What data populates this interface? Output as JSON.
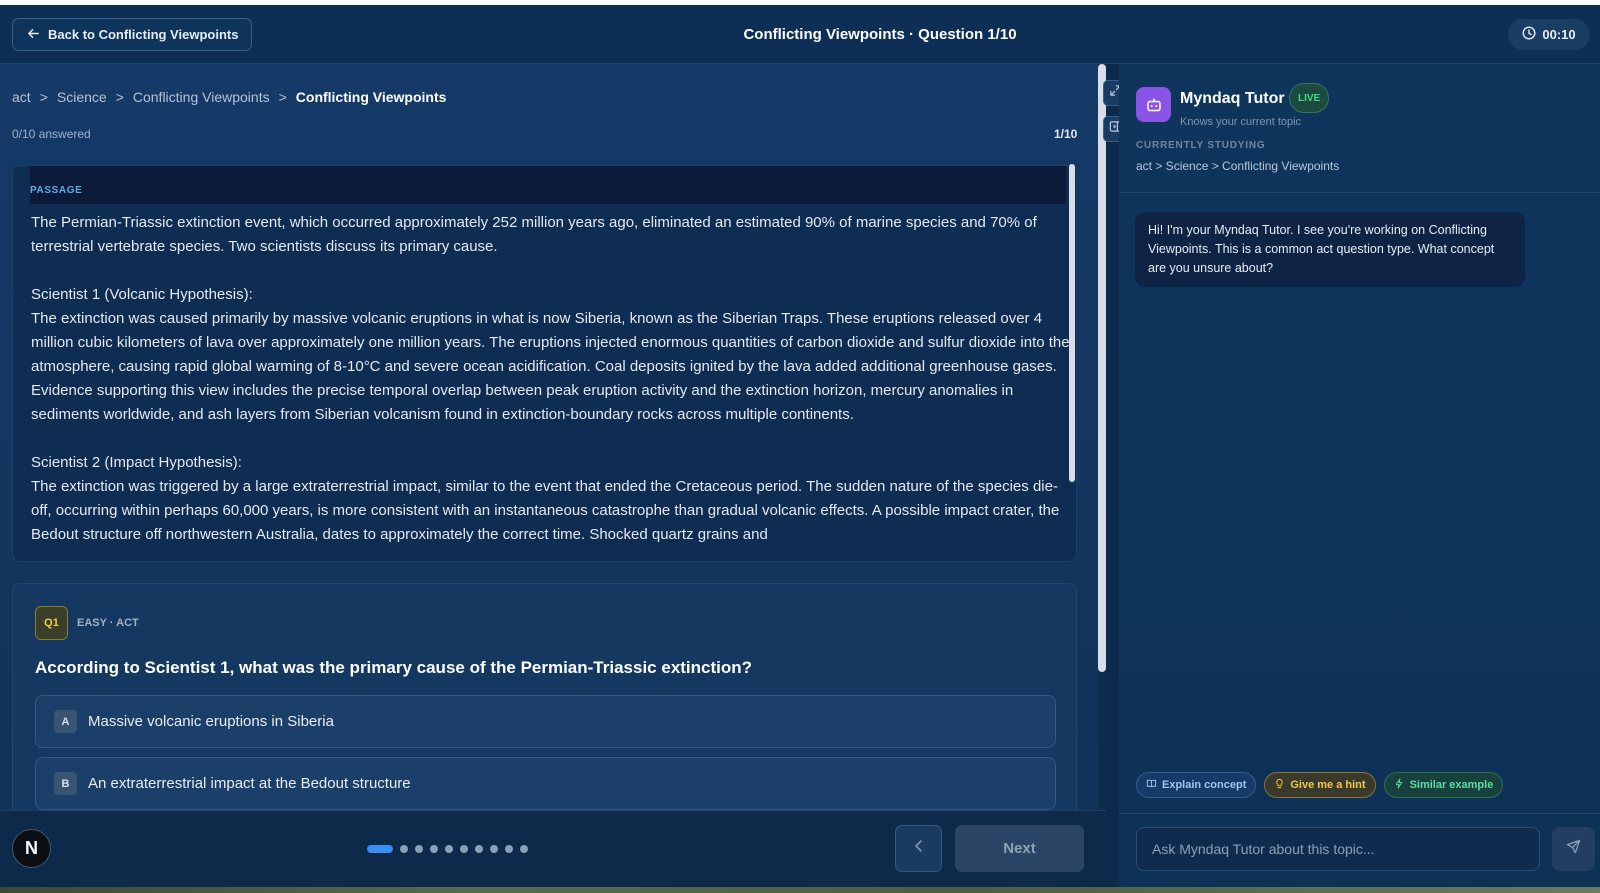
{
  "header": {
    "back_label": "Back to Conflicting Viewpoints",
    "title": "Conflicting Viewpoints · Question 1/10",
    "timer": "00:10"
  },
  "breadcrumb": {
    "items": [
      "act",
      "Science",
      "Conflicting Viewpoints"
    ],
    "current": "Conflicting Viewpoints",
    "separator": ">"
  },
  "progress": {
    "answered": "0/10 answered",
    "count": "1/10",
    "current_index": 1,
    "total": 10
  },
  "passage": {
    "label": "PASSAGE",
    "paragraphs": [
      "The Permian-Triassic extinction event, which occurred approximately 252 million years ago, eliminated an estimated 90% of marine species and 70% of terrestrial vertebrate species. Two scientists discuss its primary cause.",
      "Scientist 1 (Volcanic Hypothesis):\nThe extinction was caused primarily by massive volcanic eruptions in what is now Siberia, known as the Siberian Traps. These eruptions released over 4 million cubic kilometers of lava over approximately one million years. The eruptions injected enormous quantities of carbon dioxide and sulfur dioxide into the atmosphere, causing rapid global warming of 8-10°C and severe ocean acidification. Coal deposits ignited by the lava added additional greenhouse gases. Evidence supporting this view includes the precise temporal overlap between peak eruption activity and the extinction horizon, mercury anomalies in sediments worldwide, and ash layers from Siberian volcanism found in extinction-boundary rocks across multiple continents.",
      "Scientist 2 (Impact Hypothesis):\nThe extinction was triggered by a large extraterrestrial impact, similar to the event that ended the Cretaceous period. The sudden nature of the species die-off, occurring within perhaps 60,000 years, is more consistent with an instantaneous catastrophe than gradual volcanic effects. A possible impact crater, the Bedout structure off northwestern Australia, dates to approximately the correct time. Shocked quartz grains and"
    ]
  },
  "question": {
    "badge": "Q1",
    "meta": "EASY · ACT",
    "text": "According to Scientist 1, what was the primary cause of the Permian-Triassic extinction?",
    "options": [
      {
        "letter": "A",
        "text": "Massive volcanic eruptions in Siberia"
      },
      {
        "letter": "B",
        "text": "An extraterrestrial impact at the Bedout structure"
      }
    ]
  },
  "footer": {
    "avatar_letter": "N",
    "next_label": "Next"
  },
  "tutor": {
    "name": "Myndaq Tutor",
    "live": "LIVE",
    "subtitle": "Knows your current topic",
    "studying_label": "CURRENTLY STUDYING",
    "studying_path": "act > Science > Conflicting Viewpoints",
    "message": "Hi! I'm your Myndaq Tutor. I see you're working on Conflicting Viewpoints. This is a common act question type. What concept are you unsure about?",
    "chips": [
      "Explain concept",
      "Give me a hint",
      "Similar example"
    ],
    "input_placeholder": "Ask Myndaq Tutor about this topic..."
  },
  "colors": {
    "accent_blue": "#3b8cf5",
    "live_green": "#42d88a",
    "badge_amber": "#f2cf4a",
    "tutor_purple": "#8a55e6"
  }
}
